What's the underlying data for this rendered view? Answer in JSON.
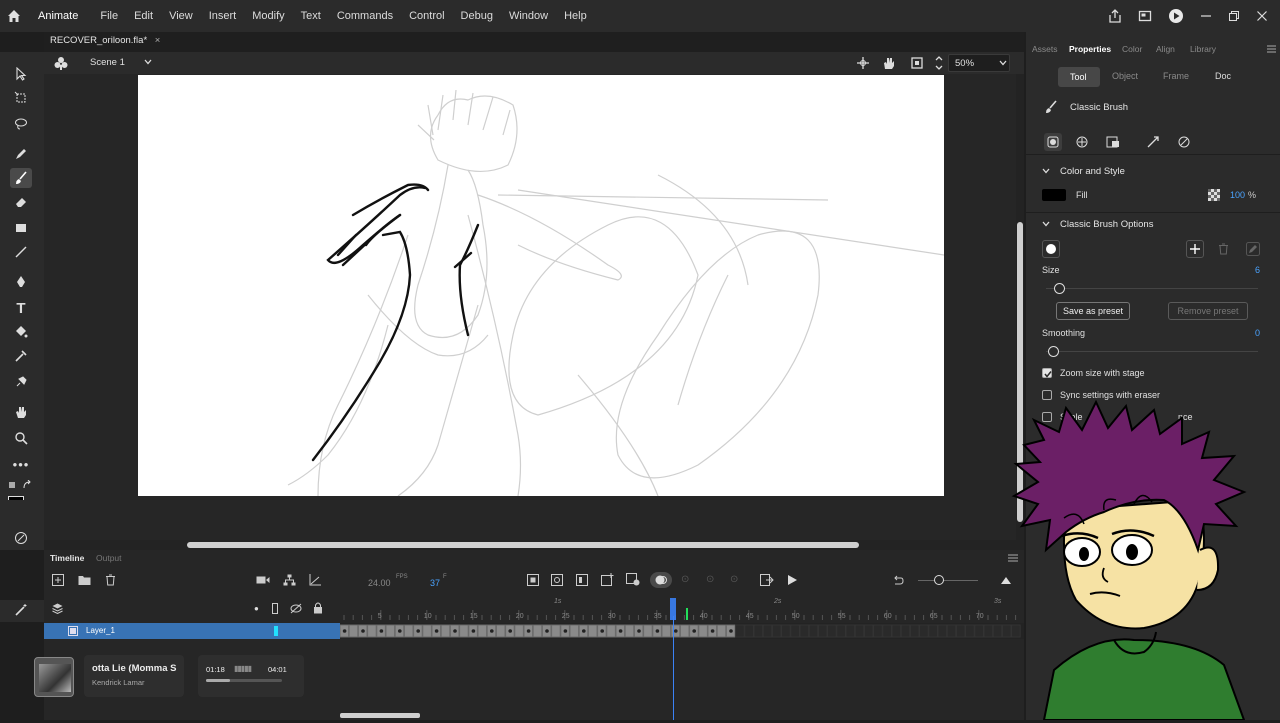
{
  "app": {
    "name": "Animate",
    "menu": [
      "File",
      "Edit",
      "View",
      "Insert",
      "Modify",
      "Text",
      "Commands",
      "Control",
      "Debug",
      "Window",
      "Help"
    ]
  },
  "document": {
    "tab_title": "RECOVER_oriloon.fla*",
    "tab_close": "×",
    "scene": "Scene 1",
    "zoom": "50%"
  },
  "timeline": {
    "tab_timeline": "Timeline",
    "tab_output": "Output",
    "fps_value": "24.00",
    "fps_unit": "FPS",
    "frame_value": "37",
    "frame_unit": "F",
    "layer_name": "Layer_1",
    "ruler_numbers": [
      "5",
      "10",
      "15",
      "20",
      "25",
      "30",
      "35",
      "40",
      "45",
      "50",
      "55",
      "60",
      "65",
      "70"
    ],
    "sec_markers": [
      "1s",
      "2s",
      "3s"
    ],
    "current_frame": 37
  },
  "media": {
    "title": "otta Lie (Momma S",
    "artist": "Kendrick Lamar",
    "elapsed": "01:18",
    "total": "04:01",
    "progress": 0.32
  },
  "panel": {
    "tabs": [
      "Assets",
      "Properties",
      "Color",
      "Align",
      "Library"
    ],
    "active_tab": "Properties",
    "subtabs": [
      "Tool",
      "Object",
      "Frame",
      "Doc"
    ],
    "active_subtab": "Tool",
    "tool_name": "Classic Brush",
    "color_style_header": "Color and Style",
    "fill_label": "Fill",
    "fill_color": "#000000",
    "fill_alpha": "100",
    "fill_alpha_unit": "%",
    "brush_options_header": "Classic Brush Options",
    "size_label": "Size",
    "size_value": "6",
    "save_preset": "Save as preset",
    "remove_preset": "Remove preset",
    "smoothing_label": "Smoothing",
    "smoothing_value": "0",
    "zoom_size_label": "Zoom size with stage",
    "sync_eraser_label": "Sync settings with eraser",
    "scale_label": "Scale",
    "scale_label_tail": "nce"
  },
  "colors": {
    "accent": "#4aa3ff",
    "playhead": "#3b82f6",
    "layer_highlight": "#3873b5",
    "hair": "#6b1f66",
    "shirt": "#2f7d2f",
    "skin": "#f6e2a4"
  }
}
